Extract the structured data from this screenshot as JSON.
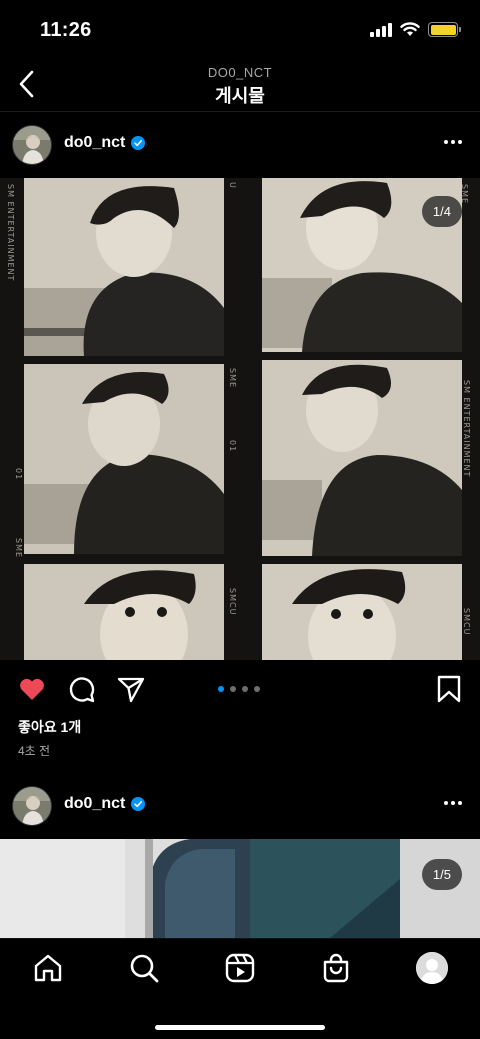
{
  "status_bar": {
    "time": "11:26"
  },
  "header": {
    "subtitle": "DO0_NCT",
    "title": "게시물"
  },
  "posts": [
    {
      "username": "do0_nct",
      "counter": "1/4",
      "likes": "좋아요 1개",
      "time_ago": "4초 전",
      "film_labels": [
        "SM ENTERTAINMENT",
        "SME",
        "01",
        "SMCU",
        "SME",
        "01",
        "SME",
        "SM ENTERTAINMENT",
        "SMCU",
        "U"
      ]
    },
    {
      "username": "do0_nct",
      "counter": "1/5"
    }
  ],
  "carousel": {
    "total": 4,
    "active": 0
  },
  "colors": {
    "like": "#ed4956",
    "verified": "#0095f6",
    "battery": "#f5d229"
  },
  "icons": [
    "back-arrow-icon",
    "verified-icon",
    "more-icon",
    "heart-icon",
    "comment-icon",
    "share-icon",
    "bookmark-icon",
    "home-icon",
    "search-icon",
    "reels-icon",
    "shop-icon",
    "profile-icon"
  ]
}
